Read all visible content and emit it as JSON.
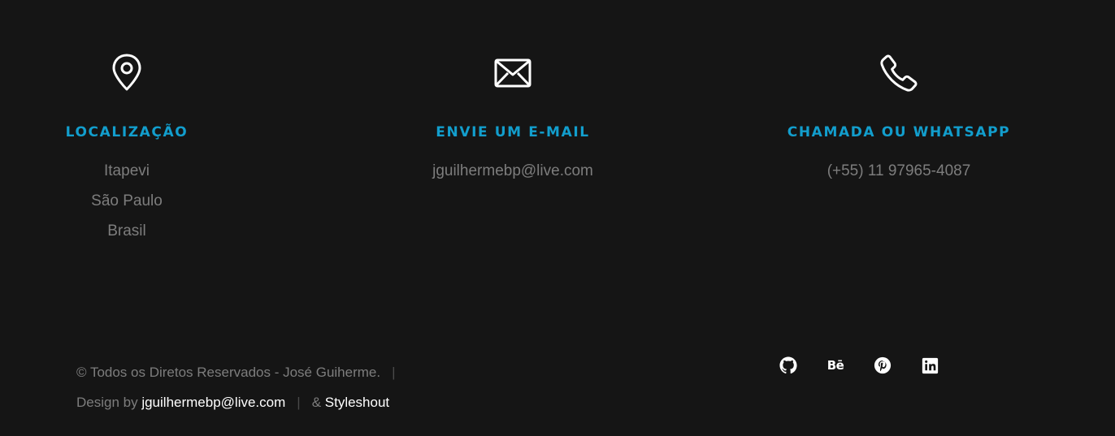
{
  "contact": {
    "location": {
      "icon": "map-pin-icon",
      "title": "LOCALIZAÇÃO",
      "lines": [
        "Itapevi",
        "São Paulo",
        "Brasil"
      ]
    },
    "email": {
      "icon": "envelope-icon",
      "title": "ENVIE UM E-MAIL",
      "lines": [
        "jguilhermebp@live.com"
      ]
    },
    "phone": {
      "icon": "phone-icon",
      "title": "CHAMADA OU WHATSAPP",
      "lines": [
        "(+55) 11 97965-4087"
      ]
    }
  },
  "copyright": {
    "text": "© Todos os Diretos Reservados - José Guiherme.",
    "separator": "|",
    "design_prefix": "Design by ",
    "design_email": "jguilhermebp@live.com",
    "amp": "& ",
    "styleshout": "Styleshout"
  },
  "social": {
    "items": [
      {
        "icon": "github-icon"
      },
      {
        "icon": "behance-icon",
        "label": "Bē"
      },
      {
        "icon": "pinterest-icon"
      },
      {
        "icon": "linkedin-icon"
      }
    ]
  },
  "colors": {
    "background": "#151515",
    "accent": "#129ecd",
    "muted_text": "#7d7d7d",
    "white": "#ffffff"
  }
}
